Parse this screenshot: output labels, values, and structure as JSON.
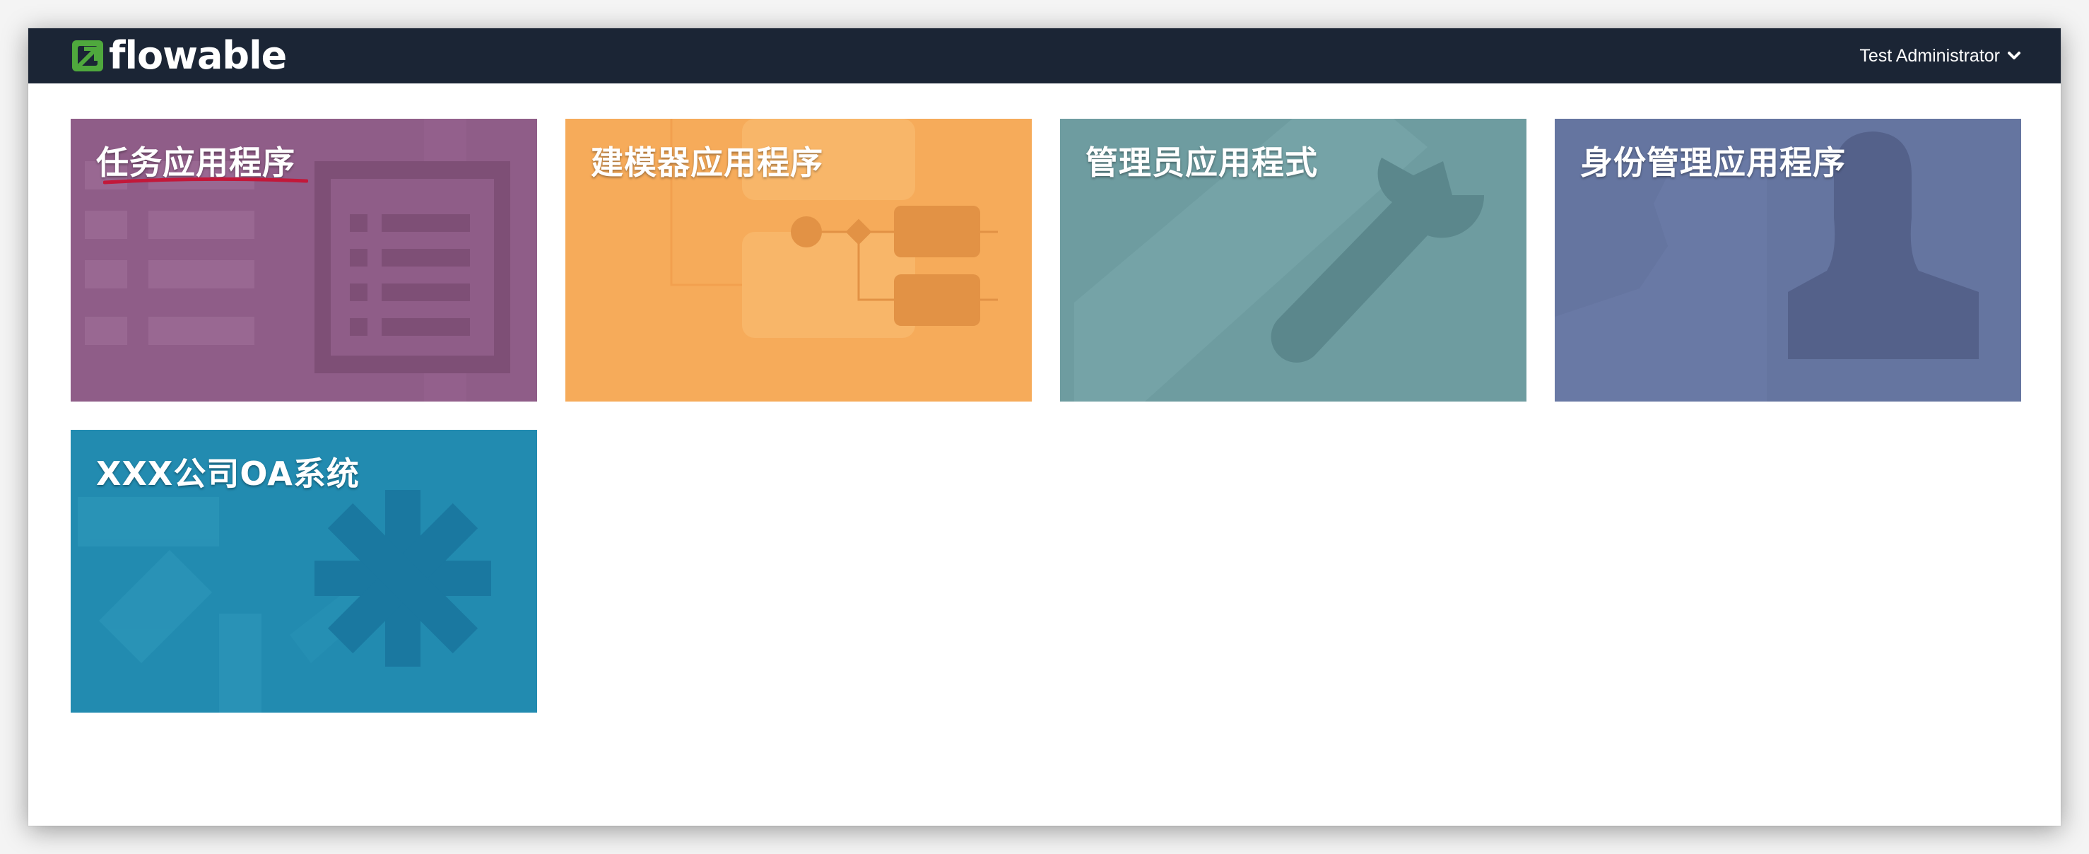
{
  "header": {
    "logo_text": "flowable",
    "user_name": "Test Administrator",
    "background_color": "#1b2535",
    "logo_icon": "flowable-arrow-logo-icon"
  },
  "apps": [
    {
      "title": "任务应用程序",
      "color": "#8f5d88",
      "icon": "task-list-icon"
    },
    {
      "title": "建模器应用程序",
      "color": "#f6ab5a",
      "icon": "process-model-icon"
    },
    {
      "title": "管理员应用程式",
      "color": "#6e9ca0",
      "icon": "wrench-icon"
    },
    {
      "title": "身份管理应用程序",
      "color": "#6575a0",
      "icon": "user-silhouette-icon"
    },
    {
      "title": "XXX公司OA系统",
      "color": "#228bb0",
      "icon": "asterisk-icon"
    }
  ]
}
